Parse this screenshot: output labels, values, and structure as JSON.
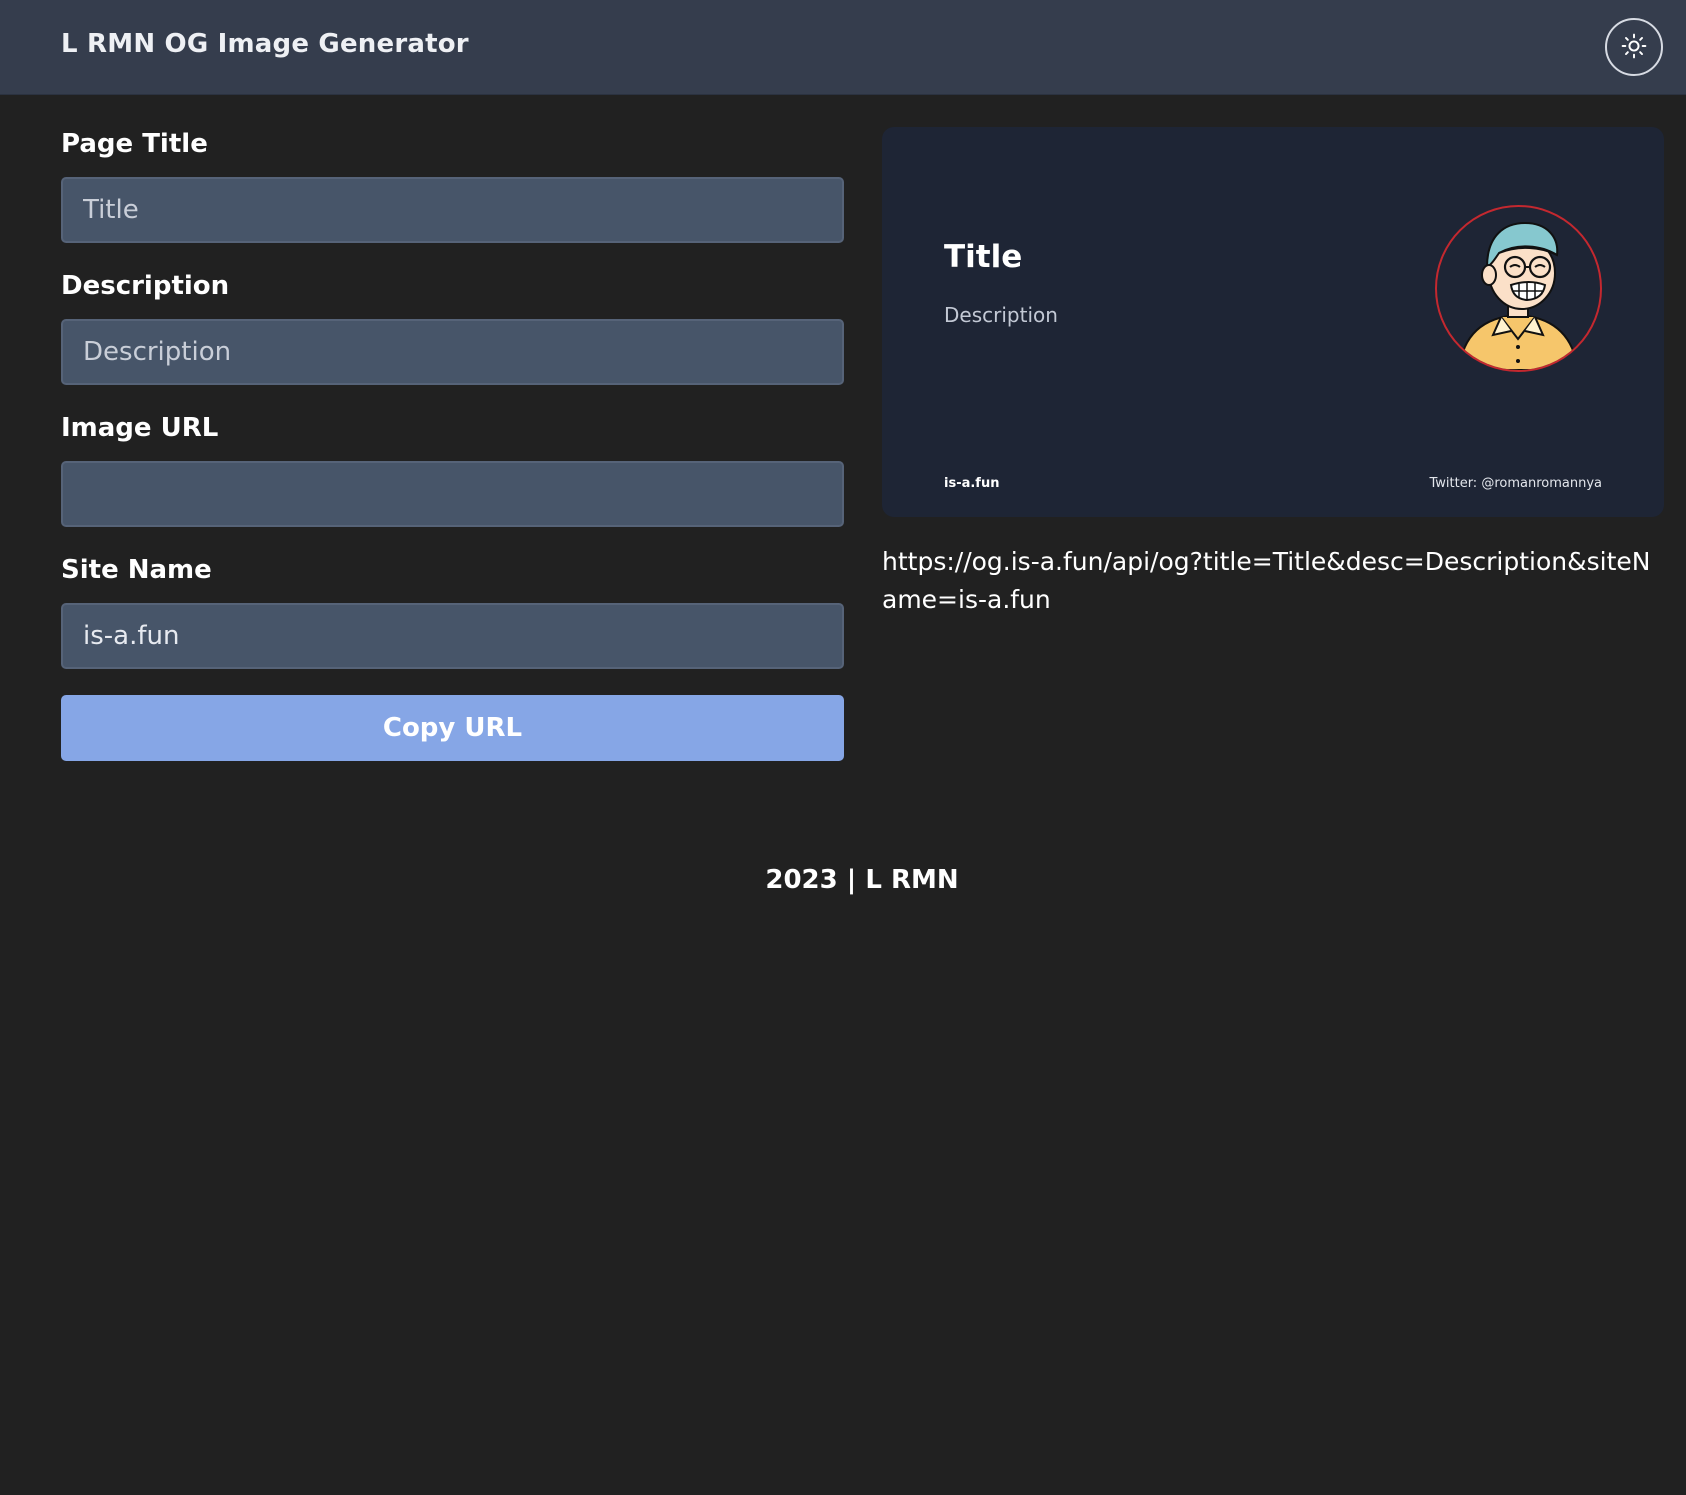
{
  "header": {
    "title": "L RMN OG Image Generator",
    "theme_toggle_icon": "sun-icon"
  },
  "form": {
    "page_title": {
      "label": "Page Title",
      "value": "",
      "placeholder": "Title"
    },
    "description": {
      "label": "Description",
      "value": "",
      "placeholder": "Description"
    },
    "image_url": {
      "label": "Image URL",
      "value": "",
      "placeholder": ""
    },
    "site_name": {
      "label": "Site Name",
      "value": "is-a.fun",
      "placeholder": ""
    },
    "copy_button": "Copy URL"
  },
  "preview": {
    "title": "Title",
    "description": "Description",
    "site_name": "is-a.fun",
    "twitter": "Twitter: @romanromannya",
    "avatar_icon": "avatar-illustration"
  },
  "generated_url": "https://og.is-a.fun/api/og?title=Title&desc=Description&siteName=is-a.fun",
  "footer": {
    "text": "2023 | L RMN"
  },
  "colors": {
    "background": "#212121",
    "header": "#353d4d",
    "input": "#475569",
    "button": "#86a6e6",
    "card": "#1e2535",
    "avatar_ring": "#c4282f"
  }
}
